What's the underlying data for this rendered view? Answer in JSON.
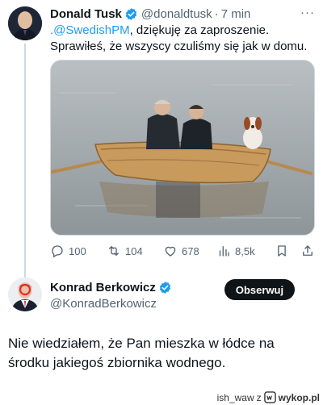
{
  "tweet1": {
    "author": {
      "name": "Donald Tusk",
      "handle": "@donaldtusk",
      "time": "7 min"
    },
    "dot": "·",
    "more": "···",
    "text": {
      "mention": ".@SwedishPM",
      "line1_rest": ", dziękuję za zaproszenie.",
      "line2": "Sprawiłeś, że wszyscy czuliśmy się jak w domu."
    },
    "stats": {
      "replies": "100",
      "retweets": "104",
      "likes": "678",
      "views": "8,5k"
    }
  },
  "tweet2": {
    "author": {
      "name": "Konrad Berkowicz",
      "handle": "@KonradBerkowicz"
    },
    "follow_label": "Obserwuj",
    "text_line1": "Nie wiedziałem, że Pan mieszka w łódce na",
    "text_line2": "środku jakiegoś zbiornika wodnego."
  },
  "watermark": {
    "user": "ish_waw",
    "z": "z",
    "site": "wykop.pl"
  },
  "colors": {
    "accent": "#1d9bf0",
    "text": "#0f1419",
    "muted": "#536471",
    "boat": "#c89a5c"
  }
}
